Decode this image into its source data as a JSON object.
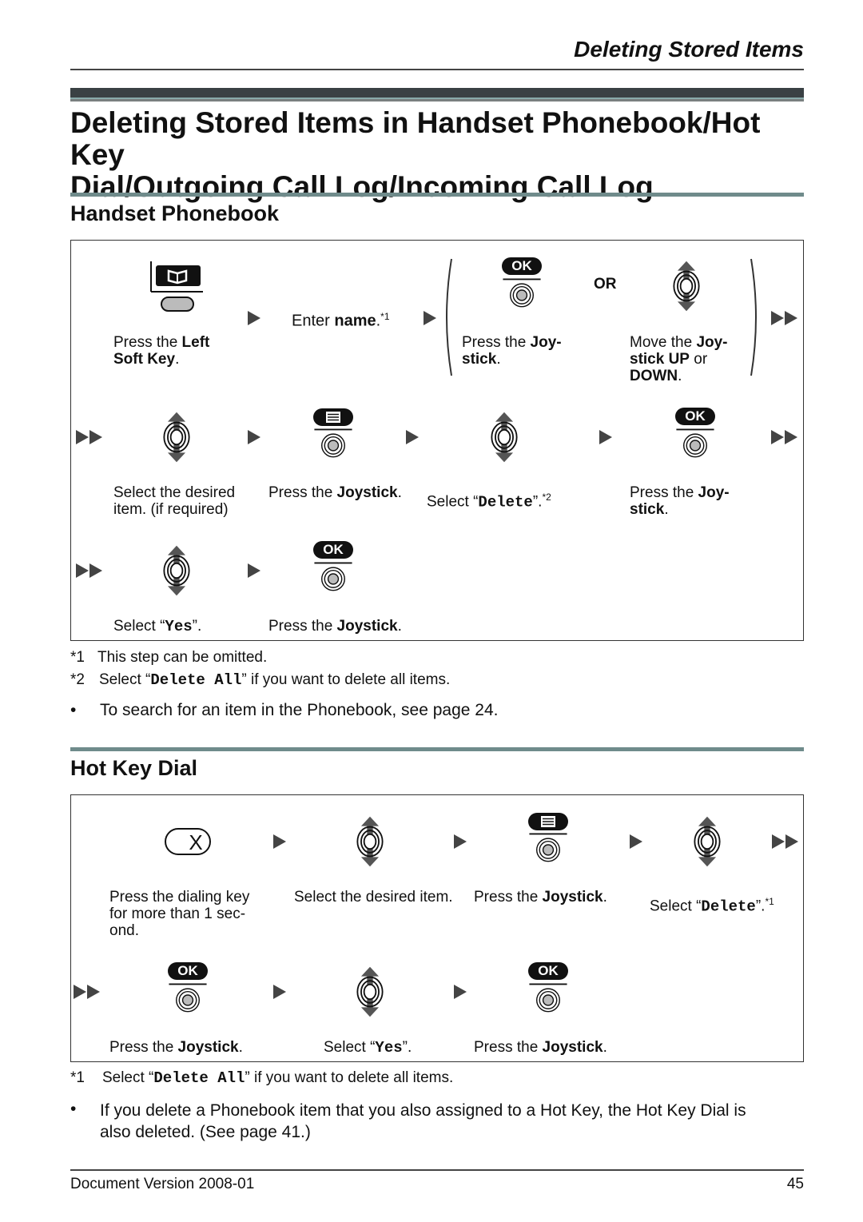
{
  "header": {
    "section_title": "Deleting Stored Items"
  },
  "page_title": "Deleting Stored Items in Handset Phonebook/Hot Key Dial/Outgoing Call Log/Incoming Call Log",
  "page_title_line1": "Deleting Stored Items in Handset Phonebook/Hot Key",
  "page_title_line2": "Dial/Outgoing Call Log/Incoming Call Log",
  "phonebook": {
    "heading": "Handset Phonebook",
    "or_label": "OR",
    "steps": {
      "s1": {
        "pre": "Press the ",
        "b1": "Left",
        "br": "",
        "b2": "Soft Key",
        "post": "."
      },
      "s2": {
        "pre": "Enter ",
        "b": "name",
        "post": ".",
        "sup": "*1"
      },
      "s3": {
        "pre": "Press the ",
        "b1": "Joy-",
        "b2": "stick",
        "post": "."
      },
      "s4": {
        "pre": "Move the ",
        "b1": "Joy-",
        "b2": "stick UP",
        "mid": " or",
        "b3": "DOWN",
        "post": "."
      },
      "s5": {
        "line1": "Select the desired",
        "line2": "item. (if required)"
      },
      "s6": {
        "pre": "Press the ",
        "b": "Joystick",
        "post": "."
      },
      "s7": {
        "pre": "Select “",
        "code": "Delete",
        "post": "”.",
        "sup": "*2"
      },
      "s8": {
        "pre": "Press the ",
        "b1": "Joy-",
        "b2": "stick",
        "post": "."
      },
      "s9": {
        "pre": "Select “",
        "code": "Yes",
        "post": "”."
      },
      "s10": {
        "pre": "Press the ",
        "b": "Joystick",
        "post": "."
      }
    },
    "footnotes": [
      {
        "mark": "*1",
        "text": "This step can be omitted."
      },
      {
        "mark": "*2",
        "pre": "Select “",
        "code": "Delete All",
        "post": "” if you want to delete all items."
      }
    ],
    "note": "To search for an item in the Phonebook, see page 24."
  },
  "hotkey": {
    "heading": "Hot Key Dial",
    "steps": {
      "s1": {
        "line1": "Press the dialing key",
        "line2": "for more than 1 sec-",
        "line3": "ond."
      },
      "s2": {
        "text": "Select the desired item."
      },
      "s3": {
        "pre": "Press the ",
        "b": "Joystick",
        "post": "."
      },
      "s4": {
        "pre": "Select “",
        "code": "Delete",
        "post": "”.",
        "sup": "*1"
      },
      "s5": {
        "pre": "Press the ",
        "b": "Joystick",
        "post": "."
      },
      "s6": {
        "pre": "Select “",
        "code": "Yes",
        "post": "”."
      },
      "s7": {
        "pre": "Press the ",
        "b": "Joystick",
        "post": "."
      }
    },
    "footnotes": [
      {
        "mark": "*1",
        "pre": "Select “",
        "code": "Delete All",
        "post": "” if you want to delete all items."
      }
    ],
    "note_line1": "If you delete a Phonebook item that you also assigned to a Hot Key, the Hot Key Dial is",
    "note_line2": "also deleted. (See page 41.)"
  },
  "icons": {
    "ok_label": "OK",
    "dial_key_label": "X",
    "bullet": "•"
  },
  "footer": {
    "version": "Document Version 2008-01",
    "page_number": "45"
  }
}
